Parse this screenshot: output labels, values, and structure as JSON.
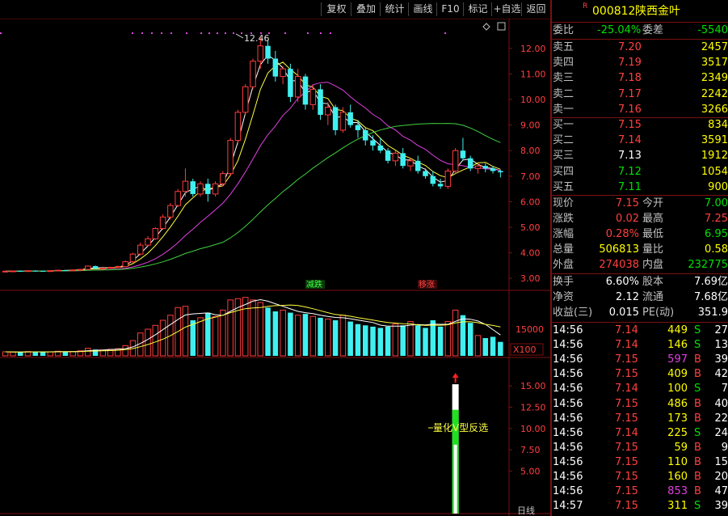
{
  "toolbar": {
    "buttons": [
      "复权",
      "叠加",
      "统计",
      "画线",
      "F10",
      "标记",
      "+自选",
      "返回"
    ]
  },
  "header": {
    "flag": "R",
    "code": "000812",
    "name": "陕西金叶"
  },
  "weibi": {
    "label1": "委比",
    "value1": "-25.04%",
    "label2": "委差",
    "value2": "-5540"
  },
  "sell_orders": [
    {
      "label": "卖五",
      "price": "7.20",
      "volume": "2457"
    },
    {
      "label": "卖四",
      "price": "7.19",
      "volume": "3517"
    },
    {
      "label": "卖三",
      "price": "7.18",
      "volume": "2349"
    },
    {
      "label": "卖二",
      "price": "7.17",
      "volume": "2242"
    },
    {
      "label": "卖一",
      "price": "7.16",
      "volume": "3266"
    }
  ],
  "buy_orders": [
    {
      "label": "买一",
      "price": "7.15",
      "volume": "834"
    },
    {
      "label": "买二",
      "price": "7.14",
      "volume": "3591"
    },
    {
      "label": "买三",
      "price": "7.13",
      "volume": "1912"
    },
    {
      "label": "买四",
      "price": "7.12",
      "volume": "1054"
    },
    {
      "label": "买五",
      "price": "7.11",
      "volume": "900"
    }
  ],
  "quote": [
    {
      "l1": "现价",
      "v1": "7.15",
      "c1": "red",
      "l2": "今开",
      "v2": "7.00",
      "c2": "green"
    },
    {
      "l1": "涨跌",
      "v1": "0.02",
      "c1": "red",
      "l2": "最高",
      "v2": "7.25",
      "c2": "red"
    },
    {
      "l1": "涨幅",
      "v1": "0.28%",
      "c1": "red",
      "l2": "最低",
      "v2": "6.95",
      "c2": "green"
    },
    {
      "l1": "总量",
      "v1": "506813",
      "c1": "yellow",
      "l2": "量比",
      "v2": "0.58",
      "c2": "yellow"
    },
    {
      "l1": "外盘",
      "v1": "274038",
      "c1": "red",
      "l2": "内盘",
      "v2": "232775",
      "c2": "green"
    }
  ],
  "stats": [
    {
      "l1": "换手",
      "v1": "6.60%",
      "l2": "股本",
      "v2": "7.69亿"
    },
    {
      "l1": "净资",
      "v1": "2.12",
      "l2": "流通",
      "v2": "7.68亿"
    },
    {
      "l1": "收益(三)",
      "v1": "0.015",
      "l2": "PE(动)",
      "v2": "351.9"
    }
  ],
  "ticks": [
    {
      "time": "14:56",
      "price": "7.14",
      "pc": "red",
      "vol": "449",
      "vc": "yellow",
      "side": "S",
      "sc": "green",
      "n": "27"
    },
    {
      "time": "14:56",
      "price": "7.14",
      "pc": "red",
      "vol": "146",
      "vc": "yellow",
      "side": "S",
      "sc": "green",
      "n": "13"
    },
    {
      "time": "14:56",
      "price": "7.15",
      "pc": "red",
      "vol": "597",
      "vc": "purple",
      "side": "B",
      "sc": "red",
      "n": "39"
    },
    {
      "time": "14:56",
      "price": "7.15",
      "pc": "red",
      "vol": "409",
      "vc": "yellow",
      "side": "B",
      "sc": "red",
      "n": "42"
    },
    {
      "time": "14:56",
      "price": "7.14",
      "pc": "red",
      "vol": "100",
      "vc": "yellow",
      "side": "S",
      "sc": "green",
      "n": "7"
    },
    {
      "time": "14:56",
      "price": "7.15",
      "pc": "red",
      "vol": "486",
      "vc": "yellow",
      "side": "B",
      "sc": "red",
      "n": "40"
    },
    {
      "time": "14:56",
      "price": "7.15",
      "pc": "red",
      "vol": "173",
      "vc": "yellow",
      "side": "B",
      "sc": "red",
      "n": "22"
    },
    {
      "time": "14:56",
      "price": "7.14",
      "pc": "red",
      "vol": "225",
      "vc": "yellow",
      "side": "S",
      "sc": "green",
      "n": "24"
    },
    {
      "time": "14:56",
      "price": "7.15",
      "pc": "red",
      "vol": "59",
      "vc": "yellow",
      "side": "B",
      "sc": "red",
      "n": "9"
    },
    {
      "time": "14:56",
      "price": "7.15",
      "pc": "red",
      "vol": "110",
      "vc": "yellow",
      "side": "B",
      "sc": "red",
      "n": "15"
    },
    {
      "time": "14:56",
      "price": "7.15",
      "pc": "red",
      "vol": "160",
      "vc": "yellow",
      "side": "B",
      "sc": "red",
      "n": "20"
    },
    {
      "time": "14:56",
      "price": "7.15",
      "pc": "red",
      "vol": "853",
      "vc": "purple",
      "side": "B",
      "sc": "red",
      "n": "47"
    },
    {
      "time": "14:57",
      "price": "7.15",
      "pc": "red",
      "vol": "311",
      "vc": "yellow",
      "side": "S",
      "sc": "green",
      "n": "39"
    }
  ],
  "chart_labels": {
    "peak": "12.46",
    "tag_left": "减跌",
    "tag_right": "移涨",
    "vol_axis_mark": "15000",
    "vol_unit": "X100",
    "signal_label": "量化V型反选",
    "bottom_right": "日线"
  },
  "colors": {
    "up": "#ff3c3c",
    "down": "#40f0f0",
    "ma_white": "#ffffff",
    "ma_yellow": "#ffff40",
    "ma_magenta": "#e040e0",
    "ma_green": "#40d040",
    "grid_red": "#7b1010"
  },
  "chart_data": {
    "type": "candlestick",
    "price_axis_ticks": [
      12.0,
      11.0,
      10.0,
      9.0,
      8.0,
      7.0,
      6.0,
      5.0,
      4.0,
      3.0
    ],
    "price_ylim": [
      2.72,
      12.85
    ],
    "signal_axis_ticks": [
      15.0,
      12.5,
      10.0,
      7.5,
      5.0
    ],
    "signal_ylim": [
      0,
      17.3
    ],
    "signal_bar": {
      "index": 60,
      "value": 15.2,
      "segments": [
        12.2,
        8.1
      ]
    },
    "candles": [
      [
        3.27,
        3.3,
        3.25,
        3.28
      ],
      [
        3.28,
        3.3,
        3.26,
        3.29
      ],
      [
        3.29,
        3.31,
        3.27,
        3.28
      ],
      [
        3.28,
        3.31,
        3.26,
        3.3
      ],
      [
        3.3,
        3.32,
        3.28,
        3.29
      ],
      [
        3.29,
        3.3,
        3.26,
        3.28
      ],
      [
        3.28,
        3.31,
        3.27,
        3.3
      ],
      [
        3.3,
        3.33,
        3.29,
        3.32
      ],
      [
        3.32,
        3.34,
        3.3,
        3.31
      ],
      [
        3.31,
        3.33,
        3.3,
        3.33
      ],
      [
        3.33,
        3.36,
        3.32,
        3.35
      ],
      [
        3.35,
        3.5,
        3.33,
        3.48
      ],
      [
        3.48,
        3.5,
        3.35,
        3.38
      ],
      [
        3.38,
        3.42,
        3.35,
        3.4
      ],
      [
        3.4,
        3.45,
        3.38,
        3.43
      ],
      [
        3.43,
        3.5,
        3.4,
        3.46
      ],
      [
        3.46,
        3.7,
        3.44,
        3.65
      ],
      [
        3.65,
        4.0,
        3.6,
        3.95
      ],
      [
        3.95,
        4.4,
        3.9,
        4.3
      ],
      [
        4.3,
        4.65,
        4.25,
        4.55
      ],
      [
        4.55,
        5.0,
        4.5,
        4.95
      ],
      [
        4.95,
        5.5,
        4.9,
        5.4
      ],
      [
        5.4,
        5.95,
        5.3,
        5.85
      ],
      [
        5.85,
        6.5,
        5.8,
        6.4
      ],
      [
        6.4,
        7.3,
        6.2,
        6.8
      ],
      [
        6.8,
        6.9,
        6.2,
        6.3
      ],
      [
        6.3,
        6.8,
        6.2,
        6.7
      ],
      [
        6.7,
        6.9,
        6.0,
        6.3
      ],
      [
        6.3,
        6.8,
        6.2,
        6.7
      ],
      [
        6.7,
        7.2,
        6.6,
        7.1
      ],
      [
        7.1,
        8.5,
        7.0,
        8.4
      ],
      [
        8.4,
        9.6,
        8.3,
        9.5
      ],
      [
        9.5,
        10.6,
        9.4,
        10.5
      ],
      [
        10.5,
        11.6,
        10.4,
        11.5
      ],
      [
        11.5,
        12.46,
        11.2,
        12.1
      ],
      [
        12.1,
        12.3,
        11.4,
        11.6
      ],
      [
        11.6,
        11.9,
        10.7,
        10.9
      ],
      [
        10.9,
        11.3,
        10.6,
        11.2
      ],
      [
        11.2,
        11.4,
        9.9,
        10.1
      ],
      [
        10.1,
        11.2,
        9.9,
        10.9
      ],
      [
        10.9,
        11.0,
        9.6,
        9.8
      ],
      [
        9.8,
        10.6,
        9.6,
        10.4
      ],
      [
        10.4,
        10.6,
        9.2,
        9.4
      ],
      [
        9.4,
        9.9,
        9.0,
        9.7
      ],
      [
        9.7,
        9.8,
        8.6,
        8.8
      ],
      [
        8.8,
        9.7,
        8.7,
        9.5
      ],
      [
        9.5,
        9.8,
        8.9,
        9.0
      ],
      [
        9.0,
        9.2,
        8.5,
        8.8
      ],
      [
        8.8,
        8.9,
        8.2,
        8.4
      ],
      [
        8.4,
        8.6,
        8.0,
        8.2
      ],
      [
        8.2,
        8.5,
        7.9,
        8.0
      ],
      [
        8.0,
        8.1,
        7.5,
        7.6
      ],
      [
        7.6,
        8.0,
        7.4,
        7.9
      ],
      [
        7.9,
        8.1,
        7.3,
        7.4
      ],
      [
        7.4,
        7.7,
        7.2,
        7.6
      ],
      [
        7.6,
        7.8,
        7.1,
        7.2
      ],
      [
        7.2,
        7.3,
        6.9,
        7.0
      ],
      [
        7.0,
        7.2,
        6.6,
        6.7
      ],
      [
        6.7,
        6.9,
        6.5,
        6.6
      ],
      [
        6.6,
        7.3,
        6.5,
        7.2
      ],
      [
        7.2,
        8.1,
        7.1,
        8.0
      ],
      [
        8.0,
        8.5,
        7.6,
        7.7
      ],
      [
        7.7,
        7.8,
        7.2,
        7.3
      ],
      [
        7.3,
        7.5,
        7.1,
        7.4
      ],
      [
        7.4,
        7.5,
        7.15,
        7.3
      ],
      [
        7.3,
        7.4,
        7.1,
        7.2
      ],
      [
        7.2,
        7.25,
        6.95,
        7.15
      ]
    ],
    "volume": [
      1.6,
      1.5,
      1.5,
      1.7,
      1.6,
      1.5,
      1.6,
      1.8,
      1.7,
      1.7,
      2.0,
      3.0,
      2.5,
      2.3,
      2.6,
      2.8,
      4.0,
      6.0,
      9.0,
      10.5,
      12.0,
      14.0,
      16.0,
      19.0,
      19.5,
      14.0,
      15.0,
      17.0,
      15.5,
      18.0,
      22.0,
      22.5,
      23.0,
      22.0,
      21.0,
      19.0,
      17.5,
      18.0,
      17.0,
      16.0,
      16.5,
      15.5,
      15.0,
      14.5,
      14.0,
      16.0,
      13.5,
      12.5,
      12.0,
      11.5,
      11.0,
      11.5,
      12.5,
      12.0,
      13.5,
      12.0,
      11.0,
      14.0,
      11.5,
      13.5,
      18.0,
      16.0,
      13.0,
      8.0,
      7.0,
      7.5,
      5.5
    ],
    "vol_ylim": [
      0,
      24.5
    ]
  }
}
